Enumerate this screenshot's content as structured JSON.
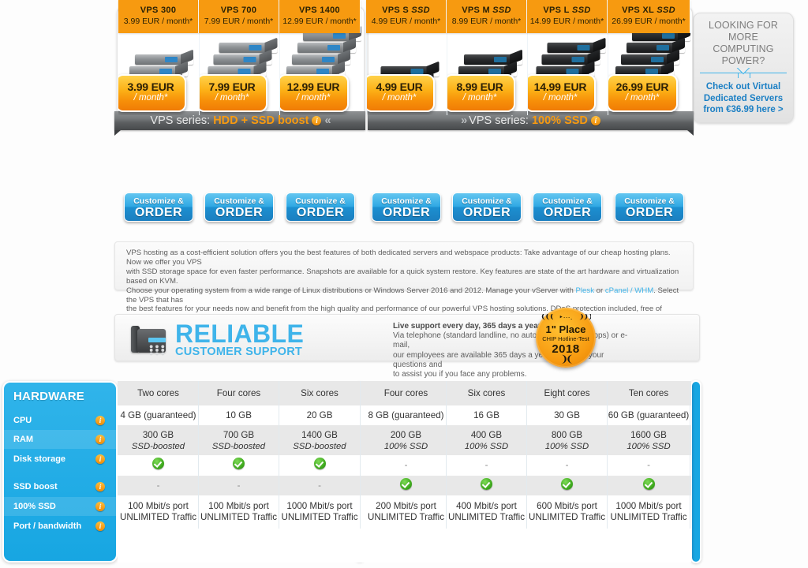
{
  "promo": {
    "title": "LOOKING FOR MORE COMPUTING POWER?",
    "subtitle": "Check out Virtual Dedicated Servers from €36.99 here >"
  },
  "series": [
    {
      "banner_prefix": "VPS series:",
      "banner_highlight": "HDD + SSD boost",
      "chevron": "«",
      "chevron_side": "right"
    },
    {
      "banner_prefix": "VPS series:",
      "banner_highlight": "100% SSD",
      "chevron": "»",
      "chevron_side": "left"
    }
  ],
  "plans": [
    {
      "name": "VPS 300",
      "name_italic": "",
      "price_big": "3.99 EUR",
      "price_period": "/ month*",
      "price_line": "3.99 EUR / month*",
      "units": 3,
      "style": "g",
      "order_l1": "Customize &",
      "order_l2": "ORDER",
      "cpu": "Two cores",
      "ram": "4 GB (guaranteed)",
      "disk_size": "300 GB",
      "disk_kind": "SSD-boosted",
      "ssd_boost": "check",
      "ssd_full": "dash",
      "port": "100 Mbit/s port",
      "traffic": "UNLIMITED Traffic"
    },
    {
      "name": "VPS 700",
      "name_italic": "",
      "price_big": "7.99 EUR",
      "price_period": "/ month*",
      "price_line": "7.99 EUR / month*",
      "units": 4,
      "style": "g",
      "order_l1": "Customize &",
      "order_l2": "ORDER",
      "cpu": "Four cores",
      "ram": "10 GB (guaranteed)",
      "disk_size": "700 GB",
      "disk_kind": "SSD-boosted",
      "ssd_boost": "check",
      "ssd_full": "dash",
      "port": "100 Mbit/s port",
      "traffic": "UNLIMITED Traffic"
    },
    {
      "name": "VPS 1400",
      "name_italic": "",
      "price_big": "12.99 EUR",
      "price_period": "/ month*",
      "price_line": "12.99 EUR / month*",
      "units": 5,
      "style": "g",
      "order_l1": "Customize &",
      "order_l2": "ORDER",
      "cpu": "Six cores",
      "ram": "20 GB (guaranteed)",
      "disk_size": "1400 GB",
      "disk_kind": "SSD-boosted",
      "ssd_boost": "check",
      "ssd_full": "dash",
      "port": "1000 Mbit/s port",
      "traffic": "UNLIMITED Traffic"
    },
    {
      "name": "VPS S",
      "name_italic": "SSD",
      "price_big": "4.99 EUR",
      "price_period": "/ month*",
      "price_line": "4.99 EUR / month*",
      "units": 2,
      "style": "b",
      "order_l1": "Customize &",
      "order_l2": "ORDER",
      "cpu": "Four cores",
      "ram": "8 GB (guaranteed)",
      "disk_size": "200 GB",
      "disk_kind": "100% SSD",
      "ssd_boost": "dash",
      "ssd_full": "check",
      "port": "200 Mbit/s port",
      "traffic": "UNLIMITED Traffic"
    },
    {
      "name": "VPS M",
      "name_italic": "SSD",
      "price_big": "8.99 EUR",
      "price_period": "/ month*",
      "price_line": "8.99 EUR / month*",
      "units": 3,
      "style": "b",
      "order_l1": "Customize &",
      "order_l2": "ORDER",
      "cpu": "Six cores",
      "ram": "16 GB (guaranteed)",
      "disk_size": "400 GB",
      "disk_kind": "100% SSD",
      "ssd_boost": "dash",
      "ssd_full": "check",
      "port": "400 Mbit/s port",
      "traffic": "UNLIMITED Traffic"
    },
    {
      "name": "VPS L",
      "name_italic": "SSD",
      "price_big": "14.99 EUR",
      "price_period": "/ month*",
      "price_line": "14.99 EUR / month*",
      "units": 4,
      "style": "b",
      "order_l1": "Customize &",
      "order_l2": "ORDER",
      "cpu": "Eight cores",
      "ram": "30 GB (guaranteed)",
      "disk_size": "800 GB",
      "disk_kind": "100% SSD",
      "ssd_boost": "dash",
      "ssd_full": "check",
      "port": "600 Mbit/s port",
      "traffic": "UNLIMITED Traffic"
    },
    {
      "name": "VPS XL",
      "name_italic": "SSD",
      "price_big": "26.99 EUR",
      "price_period": "/ month*",
      "price_line": "26.99 EUR / month*",
      "units": 5,
      "style": "b",
      "order_l1": "Customize &",
      "order_l2": "ORDER",
      "cpu": "Ten cores",
      "ram": "60 GB (guaranteed)",
      "disk_size": "1600 GB",
      "disk_kind": "100% SSD",
      "ssd_boost": "dash",
      "ssd_full": "check",
      "port": "1000 Mbit/s port",
      "traffic": "UNLIMITED Traffic"
    }
  ],
  "description": {
    "line1_a": "VPS hosting as a cost-efficient solution offers you the best features of both dedicated servers and webspace products: Take advantage of our cheap hosting plans. Now we offer you VPS",
    "line2_a": "with SSD storage space for even faster performance. Snapshots are available for a quick system restore. Key features are state of the art hardware and virtualization based on KVM.",
    "line3_a": "Choose your operating system from a wide range of Linux distributions or Windows Server 2016 and 2012. Manage your vServer with ",
    "link1": "Plesk",
    "line3_b": " or ",
    "link2": "cPanel / WHM",
    "line3_c": ". Select the VPS that has",
    "line4_a": "the best features for your needs now and benefit from the high quality and performance of our powerful VPS hosting solutions. DDoS protection included, free of charge."
  },
  "support": {
    "title_top": "RELIABLE",
    "title_bottom": "CUSTOMER SUPPORT",
    "headline": "Live support every day, 365 days a year!",
    "body1": "Via telephone (standard landline, no automated waiting loops) or e-mail,",
    "body2": "our employees are available 365 days a year to answer your questions and",
    "body3": "to assist you if you face any problems."
  },
  "award": {
    "place": "1\" Place",
    "test": "CHIP Hotline-Test",
    "year": "2018"
  },
  "hardware": {
    "title": "HARDWARE",
    "rows": [
      {
        "label": "CPU"
      },
      {
        "label": "RAM"
      },
      {
        "label": "Disk storage"
      },
      {
        "label": "SSD boost"
      },
      {
        "label": "100% SSD"
      },
      {
        "label": "Port / bandwidth"
      }
    ]
  },
  "icons": {
    "info": "i",
    "check": "check-icon",
    "dash": "-"
  },
  "colors": {
    "accent_blue": "#17a6e2",
    "accent_orange": "#f79a10",
    "banner_grey": "#5c5f61",
    "check_green": "#3faa1e"
  }
}
